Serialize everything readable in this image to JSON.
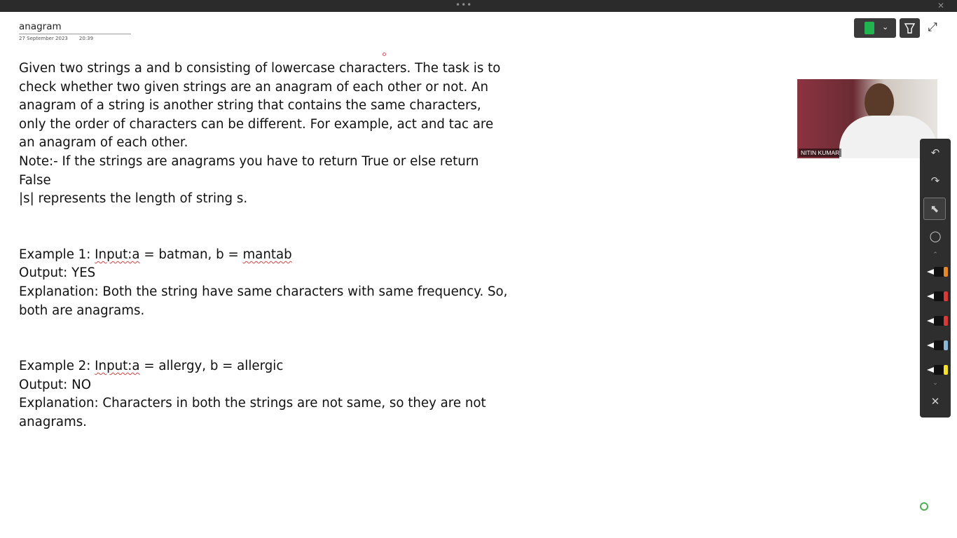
{
  "window": {
    "grip": "•••",
    "close": "✕"
  },
  "page": {
    "title": "anagram",
    "date": "27 September 2023",
    "time": "20:39"
  },
  "content": {
    "p1": "Given two strings a and b consisting of lowercase characters. The task is to check whether two given strings are an anagram of each other or not. An anagram of a string is another string that contains the same characters, only the order of characters can be different. For example, act and tac are an anagram of each other.",
    "note": "Note:- If the strings are anagrams you have to return True or else return False",
    "len": "|s| represents the length of string s.",
    "ex1_prefix": " Example 1: ",
    "ex1_input": "Input:a",
    "ex1_mid": " = batman, b = ",
    "ex1_b": "mantab",
    "ex1_output": "Output: YES",
    "ex1_expl": " Explanation: Both the string have same characters with same frequency. So, both are anagrams.",
    "ex2_prefix": "Example 2: ",
    "ex2_input": "Input:a",
    "ex2_mid": " = allergy, b = allergic",
    "ex2_output": "Output: NO",
    "ex2_expl": "Explanation: Characters in both the strings are not same, so they are not anagrams."
  },
  "video": {
    "participant_name": "NITIN KUMAR"
  },
  "toolbar": {
    "pen_color": "#20b550",
    "undo_icon": "↶",
    "redo_icon": "↷",
    "select_icon": "⬉",
    "lasso_icon": "◯",
    "scroll_up_icon": "⌃",
    "scroll_down_icon": "⌄",
    "close_icon": "✕",
    "markers": [
      {
        "name": "eraser",
        "cap_color": "#e08a2a"
      },
      {
        "name": "red-pen-1",
        "cap_color": "#d83a3a"
      },
      {
        "name": "red-pen-2",
        "cap_color": "#d83a3a"
      },
      {
        "name": "blue-pen",
        "cap_color": "#8ab4d8"
      },
      {
        "name": "yellow-highlighter",
        "cap_color": "#f5e030"
      }
    ]
  }
}
